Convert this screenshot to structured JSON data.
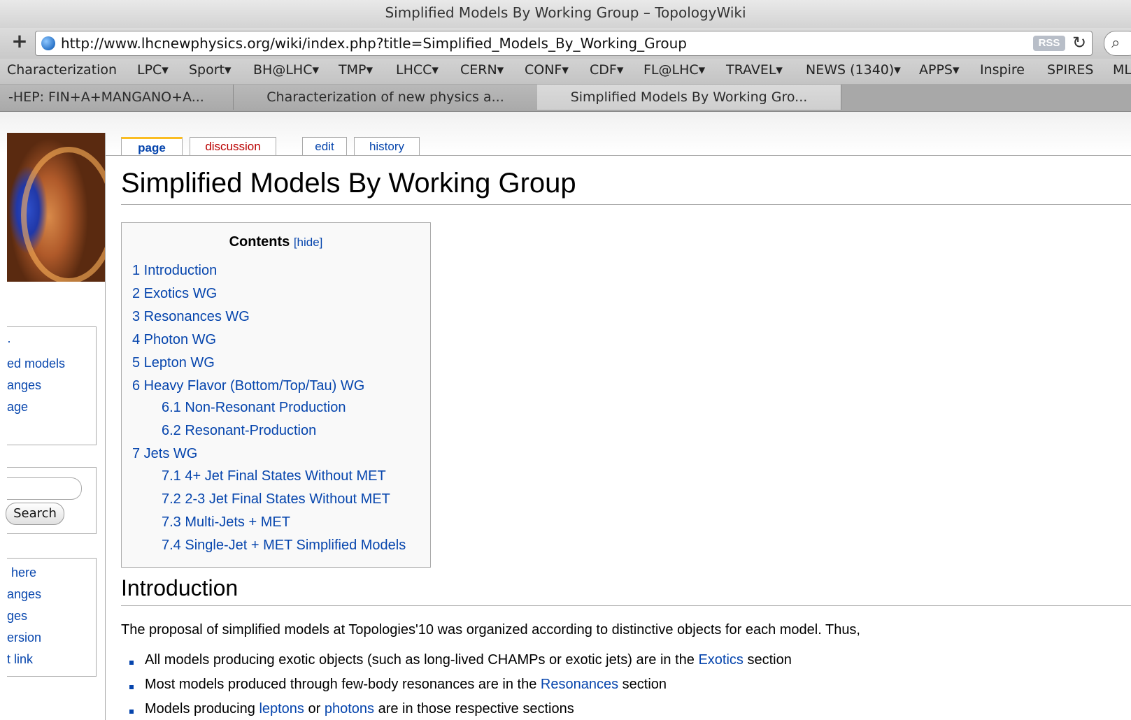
{
  "window": {
    "title": "Simplified Models By Working Group – TopologyWiki"
  },
  "toolbar": {
    "url": "http://www.lhcnewphysics.org/wiki/index.php?title=Simplified_Models_By_Working_Group",
    "rss_label": "RSS"
  },
  "bookmarks": [
    "Characterization",
    "LPC▾",
    "Sport▾",
    "BH@LHC▾",
    "TMP▾",
    "LHCC▾",
    "CERN▾",
    "CONF▾",
    "CDF▾",
    "FL@LHC▾",
    "TRAVEL▾",
    "NEWS (1340)▾",
    "APPS▾",
    "Inspire",
    "SPIRES",
    "ML"
  ],
  "tabs": [
    {
      "label": "-HEP: FIN+A+MANGANO+A..."
    },
    {
      "label": "Characterization of new physics a..."
    },
    {
      "label": "Simplified Models By Working Gro..."
    }
  ],
  "content_tabs": {
    "page": "page",
    "discussion": "discussion",
    "edit": "edit",
    "history": "history"
  },
  "sidebar": {
    "nav_items": [
      "·",
      "ed models",
      "anges",
      "age"
    ],
    "search_button": "Search",
    "toolbox_items": [
      "here",
      "anges",
      "ges",
      "ersion",
      "t link"
    ]
  },
  "page": {
    "title": "Simplified Models By Working Group"
  },
  "toc": {
    "title": "Contents",
    "hide": "[hide]",
    "items": [
      "1 Introduction",
      "2 Exotics WG",
      "3 Resonances WG",
      "4 Photon WG",
      "5 Lepton WG",
      "6 Heavy Flavor (Bottom/Top/Tau) WG",
      "6.1 Non-Resonant Production",
      "6.2 Resonant-Production",
      "7 Jets WG",
      "7.1 4+ Jet Final States Without MET",
      "7.2 2-3 Jet Final States Without MET",
      "7.3 Multi-Jets + MET",
      "7.4 Single-Jet + MET Simplified Models"
    ]
  },
  "intro": {
    "heading": "Introduction",
    "para": "The proposal of simplified models at Topologies'10 was organized according to distinctive objects for each model. Thus,",
    "b1_pre": "All models producing exotic objects (such as long-lived CHAMPs or exotic jets) are in the ",
    "b1_link": "Exotics",
    "b1_post": " section",
    "b2_pre": "Most models produced through few-body resonances are in the ",
    "b2_link": "Resonances",
    "b2_post": " section",
    "b3_pre": "Models producing ",
    "b3_link1": "leptons",
    "b3_mid": " or ",
    "b3_link2": "photons",
    "b3_post": " are in those respective sections"
  }
}
